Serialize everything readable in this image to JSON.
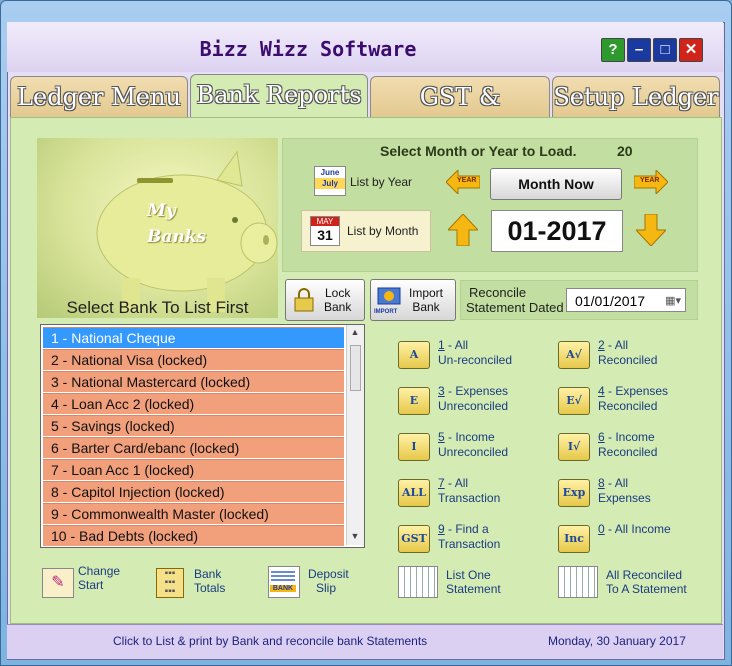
{
  "window": {
    "title": "Bizz Wizz Software",
    "buttons": {
      "help": "?",
      "minimize": "–",
      "maximize": "□",
      "close": "✕"
    }
  },
  "tabs": [
    {
      "label": "Ledger Menu",
      "active": false
    },
    {
      "label": "Bank Reports",
      "active": true
    },
    {
      "label": "GST & Reports",
      "active": false
    },
    {
      "label": "Setup Ledger",
      "active": false
    }
  ],
  "banner": {
    "pig_text_1": "My",
    "pig_text_2": "Banks",
    "caption": "Select Bank To List First"
  },
  "load": {
    "title": "Select Month or Year to Load.",
    "count": "20",
    "list_by_year": "List by Year",
    "list_by_month": "List by Month",
    "month_now": "Month Now",
    "year_arrow_left": "YEAR",
    "year_arrow_right": "YEAR",
    "period": "01-2017",
    "year_icon_text_1": "June",
    "year_icon_text_2": "July",
    "month_icon_text_1": "MAY",
    "month_icon_text_2": "31"
  },
  "actions": {
    "lock_bank_1": "Lock",
    "lock_bank_2": "Bank",
    "import_bank_1": "Import",
    "import_bank_2": "Bank",
    "import_icon_text": "IMPORT",
    "reconcile_label_1": "Reconcile",
    "reconcile_label_2": "Statement Dated",
    "reconcile_date": "01/01/2017"
  },
  "banks": [
    "1 - National Cheque",
    "2 - National Visa (locked)",
    "3 - National Mastercard (locked)",
    "4 - Loan Acc 2 (locked)",
    "5 - Savings (locked)",
    "6 - Barter Card/ebanc (locked)",
    "7 - Loan Acc 1 (locked)",
    "8 - Capitol Injection (locked)",
    "9 - Commonwealth Master (locked)",
    "10 - Bad Debts (locked)"
  ],
  "reports": [
    {
      "key": "1",
      "line1": " - All",
      "line2": "Un-reconciled",
      "icon": "A"
    },
    {
      "key": "2",
      "line1": " - All",
      "line2": "Reconciled",
      "icon": "A√"
    },
    {
      "key": "3",
      "line1": " - Expenses",
      "line2": "Unreconciled",
      "icon": "E"
    },
    {
      "key": "4",
      "line1": " - Expenses",
      "line2": "Reconciled",
      "icon": "E√"
    },
    {
      "key": "5",
      "line1": " - Income",
      "line2": "Unreconciled",
      "icon": "I"
    },
    {
      "key": "6",
      "line1": " - Income",
      "line2": "Reconciled",
      "icon": "I√"
    },
    {
      "key": "7",
      "line1": " - All",
      "line2": "Transaction",
      "icon": "ALL"
    },
    {
      "key": "8",
      "line1": " - All",
      "line2": "Expenses",
      "icon": "Exp"
    },
    {
      "key": "9",
      "line1": " - Find a",
      "line2": "Transaction",
      "icon": "GST"
    },
    {
      "key": "0",
      "line1": " - All Income",
      "line2": "",
      "icon": "Inc"
    }
  ],
  "bottom": {
    "change_start_1": "Change",
    "change_start_2": "Start",
    "bank_totals_1": "Bank",
    "bank_totals_2": "Totals",
    "deposit_slip_1": "Deposit",
    "deposit_slip_2": "Slip",
    "deposit_icon_text": "BANK",
    "list_one_1": "List One",
    "list_one_2": "Statement",
    "all_reconciled_1": "All  Reconciled",
    "all_reconciled_2": "To A Statement"
  },
  "status": {
    "hint": "Click to List & print by Bank and reconcile bank Statements",
    "date": "Monday, 30 January 2017"
  }
}
